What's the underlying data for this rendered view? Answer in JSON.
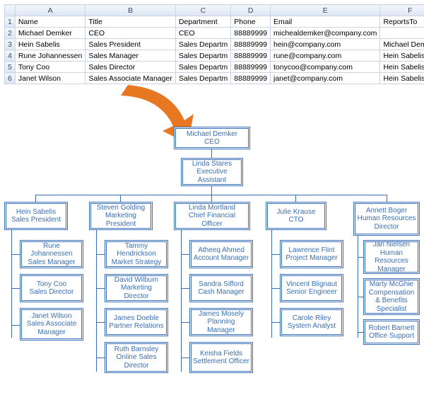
{
  "spreadsheet": {
    "columns": [
      "A",
      "B",
      "C",
      "D",
      "E",
      "F"
    ],
    "headers": {
      "name": "Name",
      "title": "Title",
      "department": "Department",
      "phone": "Phone",
      "email": "Email",
      "reportsto": "ReportsTo"
    },
    "rows": [
      {
        "n": "1",
        "name": "Name",
        "title": "Title",
        "dept": "Department",
        "phone": "Phone",
        "email": "Email",
        "reports": "ReportsTo"
      },
      {
        "n": "2",
        "name": "Michael Demker",
        "title": "CEO",
        "dept": "CEO",
        "phone": "88889999",
        "email": "michealdemker@company.com",
        "reports": ""
      },
      {
        "n": "3",
        "name": "Hein Sabelis",
        "title": "Sales President",
        "dept": "Sales Departm",
        "phone": "88889999",
        "email": "hein@company.com",
        "reports": "Michael Demker"
      },
      {
        "n": "4",
        "name": "Rune Johannessen",
        "title": "Sales Manager",
        "dept": "Sales Departm",
        "phone": "88889999",
        "email": "rune@company.com",
        "reports": "Hein Sabelis"
      },
      {
        "n": "5",
        "name": "Tony Coo",
        "title": "Sales Director",
        "dept": "Sales Departm",
        "phone": "88889999",
        "email": "tonycoo@company.com",
        "reports": "Hein Sabelis"
      },
      {
        "n": "6",
        "name": "Janet Wilson",
        "title": "Sales Associate Manager",
        "dept": "Sales Departm",
        "phone": "88889999",
        "email": "janet@company.com",
        "reports": "Hein Sabelis"
      }
    ]
  },
  "org": {
    "ceo": {
      "name": "Michael Demker",
      "title": "CEO"
    },
    "assistant": {
      "name": "Linda Stares",
      "title": "Executive Assistant"
    },
    "l2": [
      {
        "name": "Hein Sabelis",
        "title": "Sales President"
      },
      {
        "name": "Steven Golding",
        "title": "Marketing President"
      },
      {
        "name": "Linda Mortland",
        "title": "Chief Financial Officer"
      },
      {
        "name": "Julie Krause",
        "title": "CTO"
      },
      {
        "name": "Annett Boger",
        "title": "Human Resources Director"
      }
    ],
    "col0": [
      {
        "name": "Rune Johannessen",
        "title": "Sales Manager"
      },
      {
        "name": "Tony Coo",
        "title": "Sales Director"
      },
      {
        "name": "Janet Wilson",
        "title": "Sales Associate Manager"
      }
    ],
    "col1": [
      {
        "name": "Tammy Hendrickson",
        "title": "Market Strategy"
      },
      {
        "name": "David Wilburn",
        "title": "Marketing Director"
      },
      {
        "name": "James Doeble",
        "title": "Partner Relations"
      },
      {
        "name": "Ruth Barnsley",
        "title": "Online Sales Director"
      }
    ],
    "col2": [
      {
        "name": "Atheeq Ahmed",
        "title": "Account Manager"
      },
      {
        "name": "Sandra Sifford",
        "title": "Cash Manager"
      },
      {
        "name": "James Mosely",
        "title": "Planning Manager"
      },
      {
        "name": "Keisha Fields",
        "title": "Settlement Officer"
      }
    ],
    "col3": [
      {
        "name": "Lawrence Flint",
        "title": "Project Manager"
      },
      {
        "name": "Vincent Blignaut",
        "title": "Senior Engineer"
      },
      {
        "name": "Carole Riley",
        "title": "System Analyst"
      }
    ],
    "col4": [
      {
        "name": "Jan Nielsen",
        "title": "Human Resources Manager"
      },
      {
        "name": "Marty McGhie",
        "title": "Compensation & Benefits Specialist"
      },
      {
        "name": "Robert Barnett",
        "title": "Office Support"
      }
    ]
  }
}
